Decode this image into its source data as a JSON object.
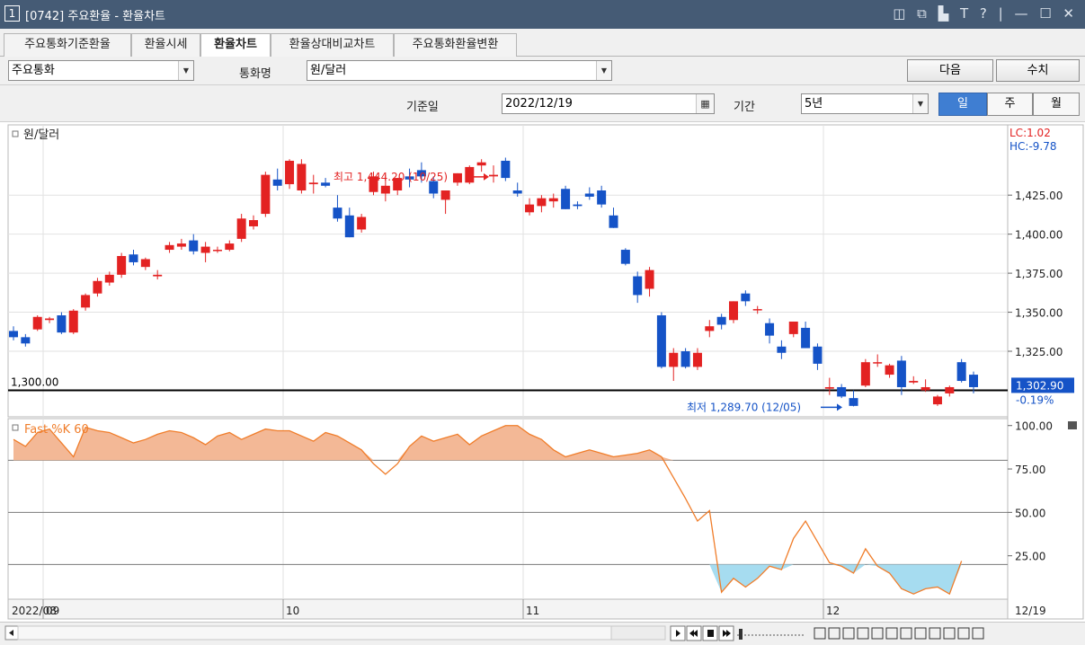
{
  "window": {
    "num": "1",
    "title": "[0742] 주요환율 - 환율차트",
    "controls": "◫ ⧉ ▙ T ? | — ☐ ✕"
  },
  "tabs": [
    "주요통화기준환율",
    "환율시세",
    "환율차트",
    "환율상대비교차트",
    "주요통화환율변환"
  ],
  "controls": {
    "currency_group": "주요통화",
    "currency_label": "통화명",
    "currency_value": "원/달러",
    "next_label": "다음",
    "values_label": "수치",
    "base_date_label": "기준일",
    "base_date": "2022/12/19",
    "period_label": "기간",
    "period_value": "5년",
    "period_buttons": [
      "일",
      "주",
      "월"
    ],
    "period_selected": "일"
  },
  "icons": {
    "calendar": "calendar-icon",
    "scroll_left": "scroll-left-icon",
    "toolbar": [
      "next-icon",
      "first-icon",
      "stop-icon",
      "last-icon",
      "slider-icon",
      "grid-icon",
      "window-icon",
      "chart-icon",
      "crosshair-icon",
      "trend-icon",
      "wave-icon",
      "pen-icon",
      "zoom-icon",
      "magnifier-icon",
      "minus-icon",
      "plus-icon",
      "text-icon"
    ]
  },
  "chart_data": [
    {
      "type": "candlestick",
      "title": "원/달러",
      "yticks": [
        "1,425.00",
        "1,400.00",
        "1,375.00",
        "1,350.00",
        "1,325.00"
      ],
      "ylim": [
        1283,
        1470
      ],
      "reference_line": {
        "value": 1300.0,
        "label": "1,300.00"
      },
      "last_price": {
        "value": "1,302.90",
        "change": "-0.19%"
      },
      "lc": "LC:1.02",
      "hc": "HC:-9.78",
      "high_annotation": {
        "text": "최고 1,444.20 (10/25)",
        "value": 1444.2
      },
      "low_annotation": {
        "text": "최저 1,289.70 (12/05)",
        "value": 1289.7
      },
      "colors": {
        "up": "#e32222",
        "down": "#1553c7"
      },
      "ohlc": [
        [
          1338,
          1341,
          1332,
          1334
        ],
        [
          1334,
          1336,
          1328,
          1330
        ],
        [
          1339,
          1348,
          1338,
          1347
        ],
        [
          1345,
          1347,
          1343,
          1346
        ],
        [
          1348,
          1350,
          1336,
          1337
        ],
        [
          1337,
          1352,
          1336,
          1351
        ],
        [
          1353,
          1362,
          1351,
          1361
        ],
        [
          1362,
          1372,
          1360,
          1370
        ],
        [
          1369,
          1376,
          1367,
          1374
        ],
        [
          1374,
          1388,
          1372,
          1386
        ],
        [
          1387,
          1390,
          1380,
          1382
        ],
        [
          1379,
          1385,
          1377,
          1384
        ],
        [
          1373,
          1377,
          1371,
          1374
        ],
        [
          1390,
          1395,
          1388,
          1393
        ],
        [
          1392,
          1397,
          1390,
          1394
        ],
        [
          1396,
          1400,
          1387,
          1389
        ],
        [
          1388,
          1395,
          1382,
          1392
        ],
        [
          1390,
          1392,
          1388,
          1390
        ],
        [
          1390,
          1396,
          1389,
          1394
        ],
        [
          1397,
          1413,
          1395,
          1410
        ],
        [
          1405,
          1412,
          1403,
          1409
        ],
        [
          1413,
          1440,
          1411,
          1438
        ],
        [
          1435,
          1442,
          1428,
          1431
        ],
        [
          1432,
          1448,
          1429,
          1447
        ],
        [
          1428,
          1448,
          1426,
          1445
        ],
        [
          1432,
          1438,
          1426,
          1433
        ],
        [
          1433,
          1436,
          1430,
          1431
        ],
        [
          1417,
          1425,
          1408,
          1410
        ],
        [
          1412,
          1417,
          1398,
          1398
        ],
        [
          1403,
          1413,
          1401,
          1411
        ],
        [
          1427,
          1440,
          1425,
          1437
        ],
        [
          1426,
          1438,
          1421,
          1431
        ],
        [
          1428,
          1436,
          1425,
          1436
        ],
        [
          1437,
          1442,
          1430,
          1435
        ],
        [
          1441,
          1446,
          1433,
          1437
        ],
        [
          1434,
          1437,
          1423,
          1426
        ],
        [
          1422,
          1428,
          1413,
          1428
        ],
        [
          1433,
          1439,
          1431,
          1439
        ],
        [
          1433,
          1444,
          1432,
          1443
        ],
        [
          1444,
          1448,
          1440,
          1446
        ],
        [
          1437,
          1444,
          1433,
          1438
        ],
        [
          1447,
          1449,
          1434,
          1436
        ],
        [
          1428,
          1433,
          1424,
          1426
        ],
        [
          1414,
          1423,
          1412,
          1419
        ],
        [
          1418,
          1425,
          1414,
          1423
        ],
        [
          1421,
          1426,
          1417,
          1423
        ],
        [
          1429,
          1431,
          1416,
          1416
        ],
        [
          1419,
          1421,
          1416,
          1418
        ],
        [
          1426,
          1430,
          1422,
          1424
        ],
        [
          1428,
          1431,
          1417,
          1419
        ],
        [
          1412,
          1417,
          1404,
          1404
        ],
        [
          1390,
          1391,
          1380,
          1381
        ],
        [
          1373,
          1376,
          1356,
          1361
        ],
        [
          1365,
          1379,
          1360,
          1377
        ],
        [
          1348,
          1350,
          1314,
          1315
        ],
        [
          1315,
          1327,
          1306,
          1324
        ],
        [
          1325,
          1327,
          1314,
          1315
        ],
        [
          1315,
          1327,
          1313,
          1324
        ],
        [
          1338,
          1345,
          1334,
          1341
        ],
        [
          1347,
          1349,
          1339,
          1342
        ],
        [
          1345,
          1357,
          1343,
          1357
        ],
        [
          1362,
          1364,
          1354,
          1357
        ],
        [
          1352,
          1354,
          1349,
          1352
        ],
        [
          1343,
          1346,
          1330,
          1335
        ],
        [
          1328,
          1332,
          1320,
          1324
        ],
        [
          1336,
          1344,
          1334,
          1344
        ],
        [
          1340,
          1344,
          1327,
          1327
        ],
        [
          1328,
          1330,
          1313,
          1317
        ],
        [
          1301,
          1308,
          1297,
          1302
        ],
        [
          1302,
          1304,
          1295,
          1296
        ],
        [
          1295,
          1300,
          1289.7,
          1290
        ],
        [
          1303,
          1320,
          1302,
          1318
        ],
        [
          1318,
          1323,
          1315,
          1318
        ],
        [
          1310,
          1317,
          1308,
          1316
        ],
        [
          1319,
          1322,
          1297,
          1302
        ],
        [
          1305,
          1309,
          1304,
          1306
        ],
        [
          1300,
          1307,
          1299,
          1302
        ],
        [
          1291,
          1297,
          1290,
          1296
        ],
        [
          1298,
          1303,
          1296,
          1302
        ],
        [
          1318,
          1320,
          1305,
          1306
        ],
        [
          1310,
          1312,
          1298,
          1302
        ]
      ]
    },
    {
      "type": "area",
      "title": "Fast %K 60",
      "yticks": [
        "100.00",
        "75.00",
        "50.00",
        "25.00"
      ],
      "ylim": [
        0,
        104
      ],
      "threshold_lines": [
        80,
        50,
        20
      ],
      "colors": {
        "line": "#f07d2a",
        "upper_fill": "#f3b896",
        "lower_fill": "#a6dcf0"
      },
      "values": [
        92,
        88,
        96,
        98,
        90,
        82,
        99,
        97,
        96,
        93,
        90,
        92,
        95,
        97,
        96,
        93,
        89,
        94,
        96,
        92,
        95,
        98,
        97,
        97,
        94,
        91,
        96,
        94,
        90,
        86,
        78,
        72,
        78,
        88,
        94,
        91,
        93,
        95,
        89,
        94,
        97,
        100,
        100,
        95,
        92,
        86,
        82,
        84,
        86,
        84,
        82,
        83,
        84,
        86,
        82,
        70,
        58,
        45,
        51,
        4,
        12,
        7,
        12,
        19,
        17,
        35,
        45,
        33,
        21,
        19,
        15,
        29,
        19,
        15,
        6,
        3,
        6,
        7,
        3,
        22
      ],
      "x_labels": [
        "2022/08",
        "09",
        "10",
        "11",
        "12",
        "12/19"
      ]
    }
  ]
}
